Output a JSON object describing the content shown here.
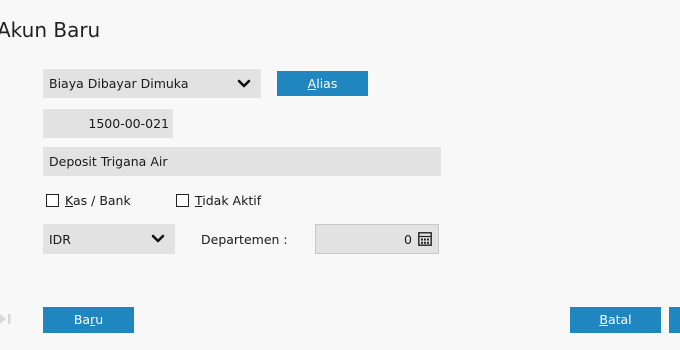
{
  "window": {
    "title": "Akun Baru"
  },
  "form": {
    "account_type": "Biaya Dibayar Dimuka",
    "alias_label_first": "A",
    "alias_label_rest": "lias",
    "account_number": "1500-00-021",
    "account_name": "Deposit Trigana Air",
    "cash_bank_first": "K",
    "cash_bank_rest": "as / Bank",
    "inactive_first": "T",
    "inactive_rest": "idak Aktif",
    "currency": "IDR",
    "department_label": "Departemen :",
    "department_value": "0"
  },
  "footer": {
    "new_prefix": "Ba",
    "new_underline": "r",
    "new_suffix": "u",
    "cancel_first": "B",
    "cancel_rest": "atal"
  },
  "colors": {
    "accent": "#1f86c0",
    "field_bg": "#e2e2e2",
    "page_bg": "#f8f8f8"
  },
  "icons": {
    "dropdown": "chevron-down-icon",
    "calculator": "calculator-icon",
    "navigation": "skip-forward-icon"
  }
}
